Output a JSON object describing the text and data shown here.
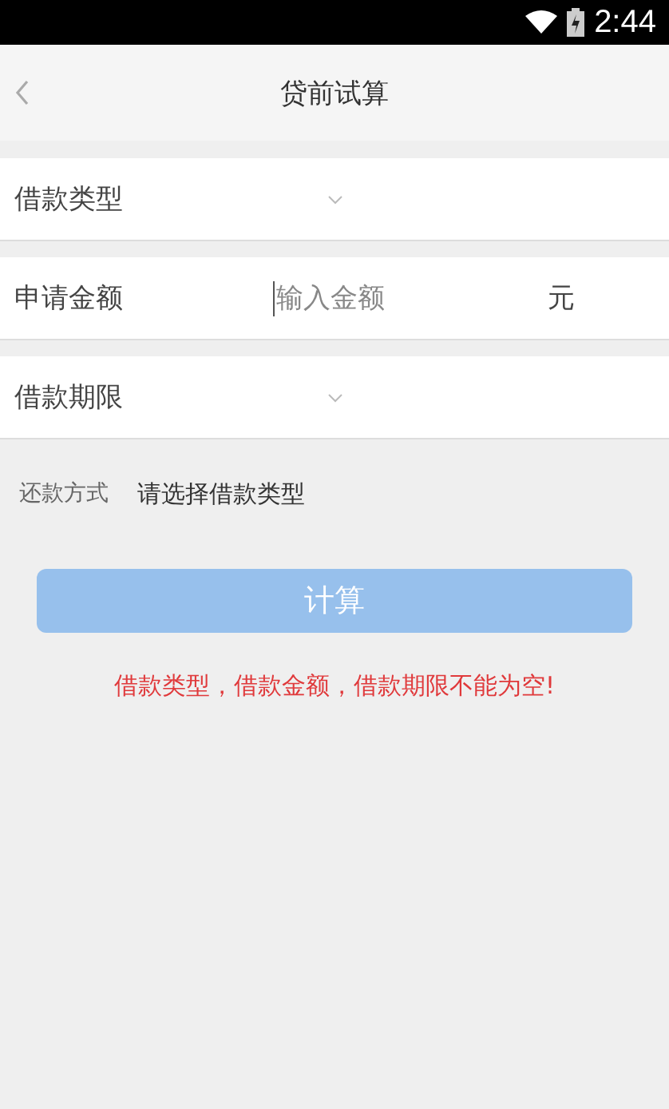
{
  "status_bar": {
    "time": "2:44"
  },
  "header": {
    "title": "贷前试算"
  },
  "fields": [
    {
      "kind": "select",
      "label": "借款类型"
    },
    {
      "kind": "input",
      "label": "申请金额",
      "placeholder": "输入金额",
      "unit": "元"
    },
    {
      "kind": "select",
      "label": "借款期限"
    }
  ],
  "repayment": {
    "label": "还款方式",
    "value": "请选择借款类型"
  },
  "calculate_button": {
    "label": "计算",
    "disabled": true
  },
  "error_message": "借款类型，借款金额，借款期限不能为空!"
}
